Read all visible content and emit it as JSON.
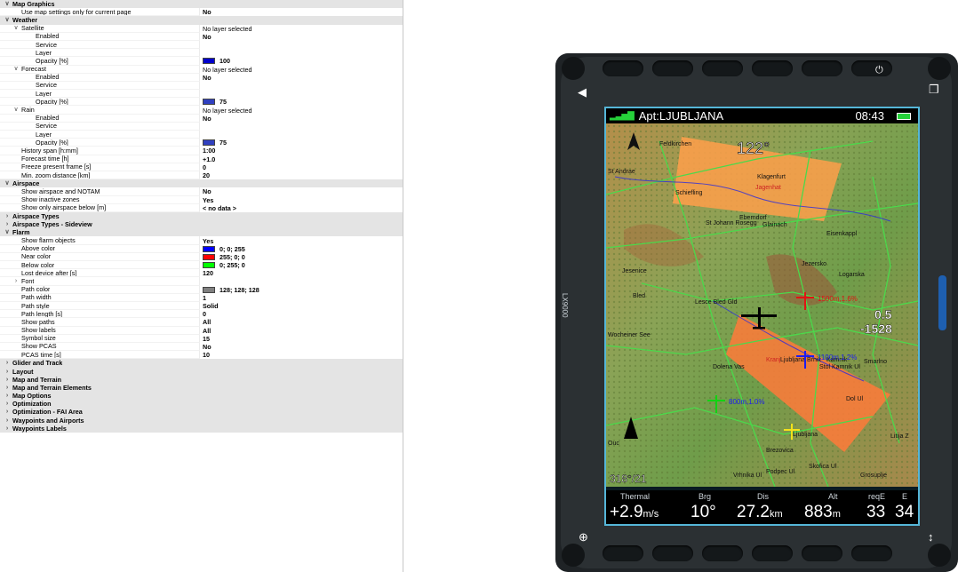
{
  "settings": {
    "rows": [
      {
        "type": "section",
        "label": "Map Graphics",
        "arrow": "v",
        "value": ""
      },
      {
        "type": "item",
        "label": "Use map settings only for current page",
        "value": "No",
        "bold": true,
        "depth": 1
      },
      {
        "type": "section",
        "label": "Weather",
        "arrow": "v",
        "value": ""
      },
      {
        "type": "group",
        "label": "Satellite",
        "arrow": "v",
        "value": "No layer selected",
        "depth": 1
      },
      {
        "type": "item",
        "label": "Enabled",
        "value": "No",
        "bold": true,
        "depth": 2
      },
      {
        "type": "item",
        "label": "Service",
        "value": "",
        "depth": 2
      },
      {
        "type": "item",
        "label": "Layer",
        "value": "",
        "depth": 2
      },
      {
        "type": "item",
        "label": "Opacity [%]",
        "value": "100",
        "bold": true,
        "swatch": "#0000cc",
        "depth": 2
      },
      {
        "type": "group",
        "label": "Forecast",
        "arrow": "v",
        "value": "No layer selected",
        "depth": 1
      },
      {
        "type": "item",
        "label": "Enabled",
        "value": "No",
        "bold": true,
        "depth": 2
      },
      {
        "type": "item",
        "label": "Service",
        "value": "",
        "depth": 2
      },
      {
        "type": "item",
        "label": "Layer",
        "value": "",
        "depth": 2
      },
      {
        "type": "item",
        "label": "Opacity [%]",
        "value": "75",
        "bold": true,
        "swatch": "#3040c0",
        "depth": 2
      },
      {
        "type": "group",
        "label": "Rain",
        "arrow": "v",
        "value": "No layer selected",
        "depth": 1
      },
      {
        "type": "item",
        "label": "Enabled",
        "value": "No",
        "bold": true,
        "depth": 2
      },
      {
        "type": "item",
        "label": "Service",
        "value": "",
        "depth": 2
      },
      {
        "type": "item",
        "label": "Layer",
        "value": "",
        "depth": 2
      },
      {
        "type": "item",
        "label": "Opacity [%]",
        "value": "75",
        "bold": true,
        "swatch": "#3040c0",
        "depth": 2
      },
      {
        "type": "item",
        "label": "History span [h:mm]",
        "value": "1:00",
        "bold": true,
        "depth": 1
      },
      {
        "type": "item",
        "label": "Forecast time [h]",
        "value": "+1.0",
        "bold": true,
        "depth": 1
      },
      {
        "type": "item",
        "label": "Freeze present frame [s]",
        "value": "0",
        "bold": true,
        "depth": 1
      },
      {
        "type": "item",
        "label": "Min. zoom distance [km]",
        "value": "20",
        "bold": true,
        "depth": 1
      },
      {
        "type": "section",
        "label": "Airspace",
        "arrow": "v",
        "value": ""
      },
      {
        "type": "item",
        "label": "Show airspace and NOTAM",
        "value": "No",
        "bold": true,
        "depth": 1
      },
      {
        "type": "item",
        "label": "Show inactive zones",
        "value": "Yes",
        "bold": true,
        "depth": 1
      },
      {
        "type": "item",
        "label": "Show only airspace below [m]",
        "value": "< no data >",
        "bold": true,
        "depth": 1
      },
      {
        "type": "section",
        "label": "Airspace Types",
        "arrow": ">",
        "value": ""
      },
      {
        "type": "section",
        "label": "Airspace Types - Sideview",
        "arrow": ">",
        "value": ""
      },
      {
        "type": "section",
        "label": "Flarm",
        "arrow": "v",
        "value": ""
      },
      {
        "type": "item",
        "label": "Show flarm objects",
        "value": "Yes",
        "bold": true,
        "depth": 1
      },
      {
        "type": "item",
        "label": "Above color",
        "value": "0; 0; 255",
        "bold": true,
        "swatch": "#0000ff",
        "depth": 1
      },
      {
        "type": "item",
        "label": "Near color",
        "value": "255; 0; 0",
        "bold": true,
        "swatch": "#ff0000",
        "depth": 1
      },
      {
        "type": "item",
        "label": "Below color",
        "value": "0; 255; 0",
        "bold": true,
        "swatch": "#00ff00",
        "depth": 1
      },
      {
        "type": "item",
        "label": "Lost device after [s]",
        "value": "120",
        "bold": true,
        "depth": 1
      },
      {
        "type": "group",
        "label": "Font",
        "arrow": ">",
        "value": "",
        "depth": 1
      },
      {
        "type": "item",
        "label": "Path color",
        "value": "128; 128; 128",
        "bold": true,
        "swatch": "#808080",
        "depth": 1
      },
      {
        "type": "item",
        "label": "Path width",
        "value": "1",
        "bold": true,
        "depth": 1
      },
      {
        "type": "item",
        "label": "Path style",
        "value": "Solid",
        "bold": true,
        "depth": 1
      },
      {
        "type": "item",
        "label": "Path length [s]",
        "value": "0",
        "bold": true,
        "depth": 1
      },
      {
        "type": "item",
        "label": "Show paths",
        "value": "All",
        "bold": true,
        "depth": 1
      },
      {
        "type": "item",
        "label": "Show labels",
        "value": "All",
        "bold": true,
        "depth": 1
      },
      {
        "type": "item",
        "label": "Symbol size",
        "value": "15",
        "bold": true,
        "depth": 1
      },
      {
        "type": "item",
        "label": "Show PCAS",
        "value": "No",
        "bold": true,
        "depth": 1
      },
      {
        "type": "item",
        "label": "PCAS time [s]",
        "value": "10",
        "bold": true,
        "depth": 1
      },
      {
        "type": "section",
        "label": "Glider and Track",
        "arrow": ">",
        "value": ""
      },
      {
        "type": "section",
        "label": "Layout",
        "arrow": ">",
        "value": ""
      },
      {
        "type": "section",
        "label": "Map and Terrain",
        "arrow": ">",
        "value": ""
      },
      {
        "type": "section",
        "label": "Map and Terrain Elements",
        "arrow": ">",
        "value": ""
      },
      {
        "type": "section",
        "label": "Map Options",
        "arrow": ">",
        "value": ""
      },
      {
        "type": "section",
        "label": "Optimization",
        "arrow": ">",
        "value": ""
      },
      {
        "type": "section",
        "label": "Optimization - FAI Area",
        "arrow": ">",
        "value": ""
      },
      {
        "type": "section",
        "label": "Waypoints and Airports",
        "arrow": ">",
        "value": ""
      },
      {
        "type": "section",
        "label": "Waypoints Labels",
        "arrow": ">",
        "value": ""
      }
    ]
  },
  "device": {
    "model": "LX9000",
    "top": {
      "title": "Apt:LJUBLJANA",
      "time": "08:43"
    },
    "map": {
      "heading": "122°",
      "wind": "318°/21",
      "vario_label": "0.5",
      "altitude_label": "-1528",
      "flarm_labels": [
        "1500m,1.6%",
        "1100m,1.2%",
        "800m,1.0%"
      ],
      "places": [
        "Feldkirchen",
        "St Andrae",
        "Klagenfurt",
        "Schiefling",
        "Jagenhat",
        "St Johann Rosegg",
        "Eberndorf",
        "Glainach",
        "Eisenkappl",
        "Jesenice",
        "Jezersko",
        "Logarska",
        "Lesce Bled Gld",
        "Bled",
        "Wocheiner See",
        "Kranj",
        "Ljubljana Brnik",
        "Kamnik",
        "Stol Kamnik Ul",
        "Smarlno",
        "Dolena Vas",
        "Dol Ul",
        "Ljubljana",
        "Litija Z",
        "Brezovica",
        "Podpec Ul",
        "Vrhnika Ul",
        "Skofica Ul",
        "Grosuplje",
        "Ouc"
      ]
    },
    "bottom": [
      {
        "label": "Thermal",
        "value": "+2.9",
        "unit": "m/s"
      },
      {
        "label": "Brg",
        "value": "10°",
        "unit": ""
      },
      {
        "label": "Dis",
        "value": "27.2",
        "unit": "km"
      },
      {
        "label": "Alt",
        "value": "883",
        "unit": "m"
      },
      {
        "label": "reqE",
        "value": "33",
        "unit": ""
      },
      {
        "label": "E",
        "value": "34",
        "unit": ""
      }
    ],
    "icons": [
      "volume-icon",
      "power-icon",
      "copy-icon",
      "zoom-icon",
      "updown-icon"
    ]
  }
}
